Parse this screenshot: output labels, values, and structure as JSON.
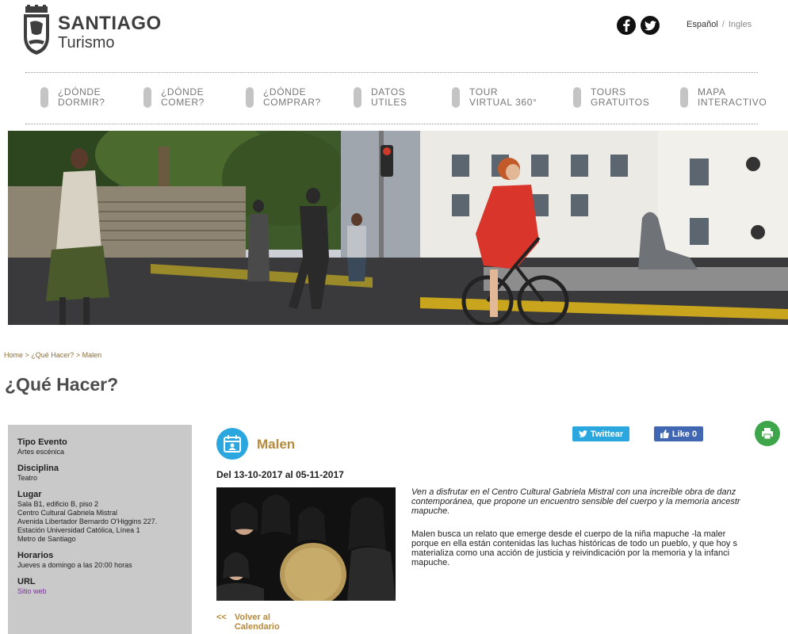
{
  "header": {
    "brand_title": "SANTIAGO",
    "brand_subtitle": "Turismo",
    "social": [
      {
        "icon": "facebook-icon",
        "glyph": "f"
      },
      {
        "icon": "twitter-icon",
        "glyph": "t"
      }
    ],
    "lang_current": "Español",
    "lang_sep": "/",
    "lang_other": "Ingles"
  },
  "nav": [
    {
      "label": "¿Dónde\nDormir?"
    },
    {
      "label": "¿Dónde\nComer?"
    },
    {
      "label": "¿Dónde\nComprar?"
    },
    {
      "label": "Datos\nUtiles"
    },
    {
      "label": "Tour\nVirtual 360°"
    },
    {
      "label": "Tours\nGratuitos"
    },
    {
      "label": "Mapa\nInteractivo"
    }
  ],
  "breadcrumb": {
    "home": "Home",
    "sep": " > ",
    "section": "¿Qué Hacer?",
    "current": "Malen"
  },
  "page_title": "¿Qué Hacer?",
  "sidebar": {
    "tipo_label": "Tipo Evento",
    "tipo_value": "Artes escénica",
    "disciplina_label": "Disciplina",
    "disciplina_value": "Teatro",
    "lugar_label": "Lugar",
    "lugar_lines": [
      "Sala B1, edificio B, piso 2",
      "Centro Cultural Gabriela Mistral",
      "Avenida  Libertador Bernardo O'Higgins 227.",
      "Estación Universidad Católica, Línea 1",
      "Metro de Santiago"
    ],
    "horarios_label": "Horarios",
    "horarios_value": "Jueves a domingo a las 20:00 horas",
    "url_label": "URL",
    "url_value": "Sitio web"
  },
  "event": {
    "title": "Malen",
    "dates": "Del 13-10-2017 al 05-11-2017",
    "twitter_label": "Twittear",
    "like_label": "Like 0",
    "desc_p1": [
      "Ven a disfrutar en el Centro Cultural Gabriela Mistral con una increíble  obra de danz",
      "contemporánea, que propone un encuentro sensible del cuerpo y la memoria ancestr",
      "mapuche."
    ],
    "desc_p2": [
      "Malen busca un relato que emerge desde el cuerpo de la niña mapuche -la maler",
      "porque en ella están contenidas las luchas históricas de todo un pueblo, y que hoy s",
      "materializa como una acción de justicia y reivindicación por la memoria y la infanci",
      "mapuche."
    ],
    "back_arrows": "<<",
    "back_label_1": "Volver al",
    "back_label_2": "Calendario"
  },
  "colors": {
    "accent_gold": "#b58a3a",
    "twitter_blue": "#2aa7de",
    "facebook_blue": "#4267b2",
    "print_green": "#3fa54a",
    "sidebar_gray": "#c9c9c9"
  }
}
